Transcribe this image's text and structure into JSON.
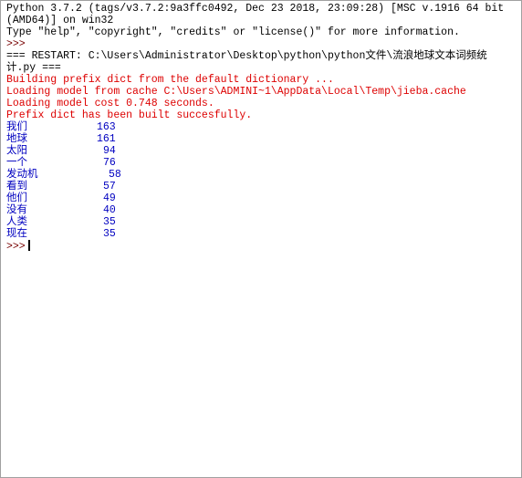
{
  "shell": {
    "banner": [
      "Python 3.7.2 (tags/v3.7.2:9a3ffc0492, Dec 23 2018, 23:09:28) [MSC v.1916 64 bit",
      "(AMD64)] on win32",
      "Type \"help\", \"copyright\", \"credits\" or \"license()\" for more information."
    ],
    "prompt": ">>>",
    "restart": [
      "=== RESTART: C:\\Users\\Administrator\\Desktop\\python\\python文件\\流浪地球文本词频统",
      "计.py ==="
    ],
    "stderr": [
      "Building prefix dict from the default dictionary ...",
      "Loading model from cache C:\\Users\\ADMINI~1\\AppData\\Local\\Temp\\jieba.cache",
      "Loading model cost 0.748 seconds.",
      "Prefix dict has been built succesfully."
    ],
    "word_counts": [
      {
        "word": "我们",
        "count": "163"
      },
      {
        "word": "地球",
        "count": "161"
      },
      {
        "word": "太阳",
        "count": "94"
      },
      {
        "word": "一个",
        "count": "76"
      },
      {
        "word": "发动机",
        "count": "58"
      },
      {
        "word": "看到",
        "count": "57"
      },
      {
        "word": "他们",
        "count": "49"
      },
      {
        "word": "没有",
        "count": "40"
      },
      {
        "word": "人类",
        "count": "35"
      },
      {
        "word": "现在",
        "count": "35"
      }
    ]
  },
  "colors": {
    "stdout": "#0000c0",
    "stderr": "#dd0000",
    "prompt": "#770000"
  }
}
